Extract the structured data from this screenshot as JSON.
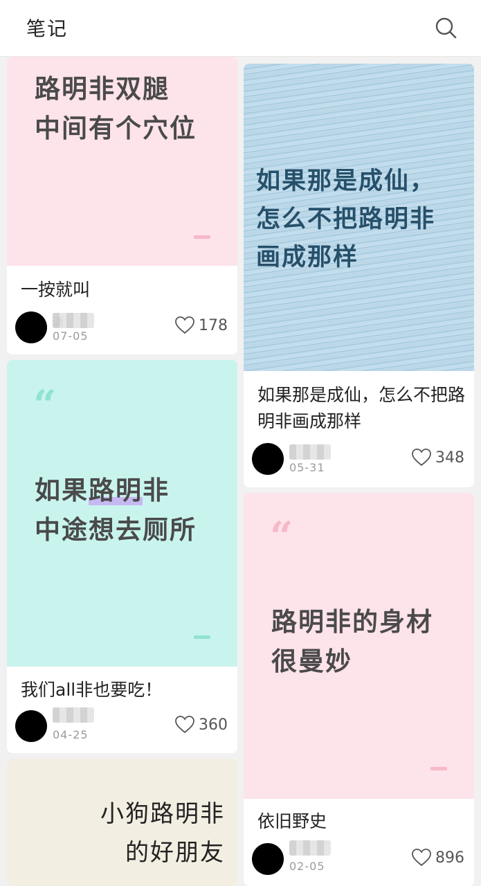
{
  "header": {
    "title": "笔记"
  },
  "cards": [
    {
      "cover_text": "路明非双腿\n中间有个穴位",
      "caption": "一按就叫",
      "author": "潇",
      "date": "07-05",
      "likes": "178",
      "bg": "#fde3ea"
    },
    {
      "cover_text": "如果那是成仙，\n怎么不把路明非\n画成那样",
      "caption": "如果那是成仙，怎么不把路明非画成那样",
      "date": "05-31",
      "likes": "348",
      "bg": "#b9d6e6"
    },
    {
      "cover_text_1": "如果",
      "cover_text_highlight": "路明",
      "cover_text_2": "非\n中途想去厕所",
      "caption": "我们all非也要吃！",
      "date": "04-25",
      "likes": "360",
      "bg": "#c9f4ee"
    },
    {
      "cover_text": "路明非的身材\n很曼妙",
      "caption": "依旧野史",
      "date": "02-05",
      "likes": "896",
      "bg": "#fde3ea"
    },
    {
      "cover_text": "小狗路明非\n的好朋友",
      "bg": "#f3eee2"
    }
  ],
  "colors": {
    "pink_quote": "#f7b8c8",
    "teal_quote": "#8fe3d2",
    "ink_blue": "#26506a"
  }
}
